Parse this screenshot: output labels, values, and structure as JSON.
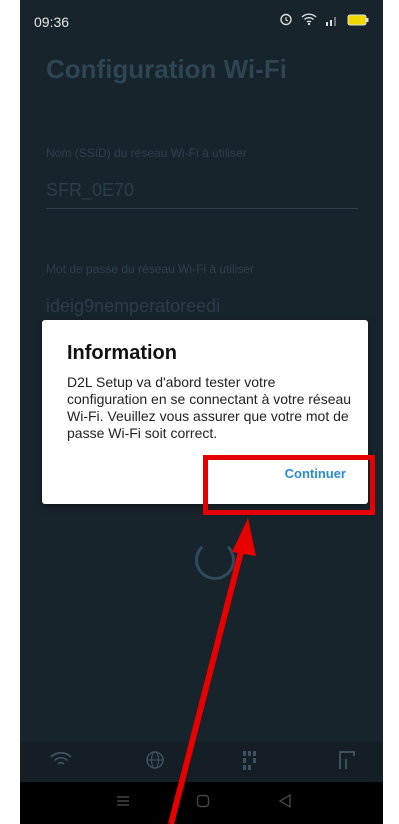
{
  "status_bar": {
    "time": "09:36"
  },
  "page": {
    "title": "Configuration Wi-Fi"
  },
  "fields": {
    "ssid_label": "Nom (SSID) du réseau Wi-Fi à utiliser",
    "ssid_value": "SFR_0E70",
    "password_label": "Mot de passe du réseau Wi-Fi à utiliser",
    "password_value": "ideig9nemperatoreedi"
  },
  "dialog": {
    "title": "Information",
    "body": "D2L Setup va d'abord tester votre configuration en se connectant à votre réseau Wi-Fi. Veuillez vous assurer que votre mot de passe Wi-Fi soit correct.",
    "button_label": "Continuer"
  },
  "colors": {
    "accent": "#2a8bd6",
    "annotation": "#e60000",
    "background": "#18242c"
  }
}
